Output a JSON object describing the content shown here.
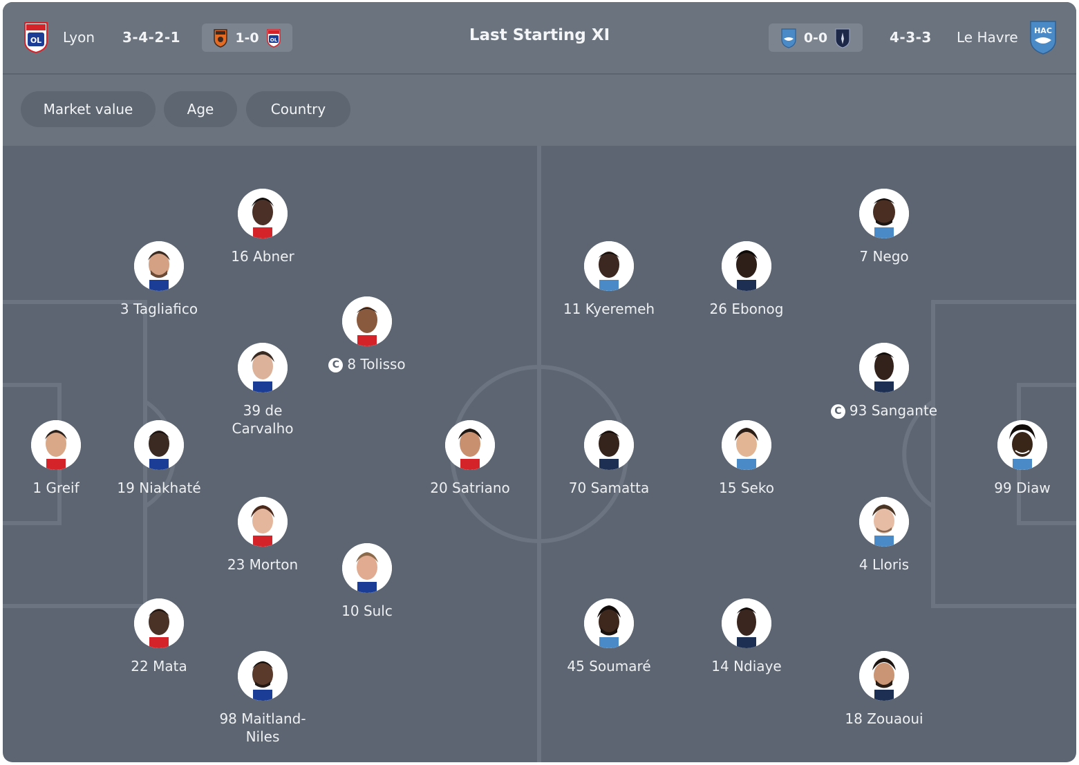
{
  "header": {
    "title": "Last Starting XI",
    "home": {
      "name": "Lyon",
      "formation": "3-4-2-1",
      "last_result": "1-0",
      "crest_icon": "lyon-crest-icon"
    },
    "away": {
      "name": "Le Havre",
      "formation": "4-3-3",
      "last_result": "0-0",
      "crest_icon": "le-havre-crest-icon",
      "crest_text": "HAC"
    }
  },
  "filters": [
    {
      "label": "Market value"
    },
    {
      "label": "Age"
    },
    {
      "label": "Country"
    }
  ],
  "home_players": [
    {
      "number": "1",
      "name": "Greif",
      "captain": false
    },
    {
      "number": "3",
      "name": "Tagliafico",
      "captain": false
    },
    {
      "number": "19",
      "name": "Niakhaté",
      "captain": false
    },
    {
      "number": "22",
      "name": "Mata",
      "captain": false
    },
    {
      "number": "16",
      "name": "Abner",
      "captain": false
    },
    {
      "number": "39",
      "name": "de Carvalho",
      "captain": false
    },
    {
      "number": "23",
      "name": "Morton",
      "captain": false
    },
    {
      "number": "98",
      "name": "Maitland-Niles",
      "captain": false
    },
    {
      "number": "8",
      "name": "Tolisso",
      "captain": true
    },
    {
      "number": "10",
      "name": "Sulc",
      "captain": false
    },
    {
      "number": "20",
      "name": "Satriano",
      "captain": false
    }
  ],
  "away_players": [
    {
      "number": "11",
      "name": "Kyeremeh",
      "captain": false
    },
    {
      "number": "70",
      "name": "Samatta",
      "captain": false
    },
    {
      "number": "45",
      "name": "Soumaré",
      "captain": false
    },
    {
      "number": "26",
      "name": "Ebonog",
      "captain": false
    },
    {
      "number": "15",
      "name": "Seko",
      "captain": false
    },
    {
      "number": "14",
      "name": "Ndiaye",
      "captain": false
    },
    {
      "number": "7",
      "name": "Nego",
      "captain": false
    },
    {
      "number": "93",
      "name": "Sangante",
      "captain": true
    },
    {
      "number": "4",
      "name": "Lloris",
      "captain": false
    },
    {
      "number": "18",
      "name": "Zouaoui",
      "captain": false
    },
    {
      "number": "99",
      "name": "Diaw",
      "captain": false
    }
  ],
  "captain_marker": "C",
  "colors": {
    "card_bg": "#5c6571",
    "header_bg": "#6a737e",
    "pitch_lines": "#6b7480",
    "lyon_red": "#d5232a",
    "lyon_blue": "#1c3d96",
    "lorient_orange": "#e36b24",
    "havre_blue": "#4a8ac6",
    "paris_fc_navy": "#1d2747"
  }
}
